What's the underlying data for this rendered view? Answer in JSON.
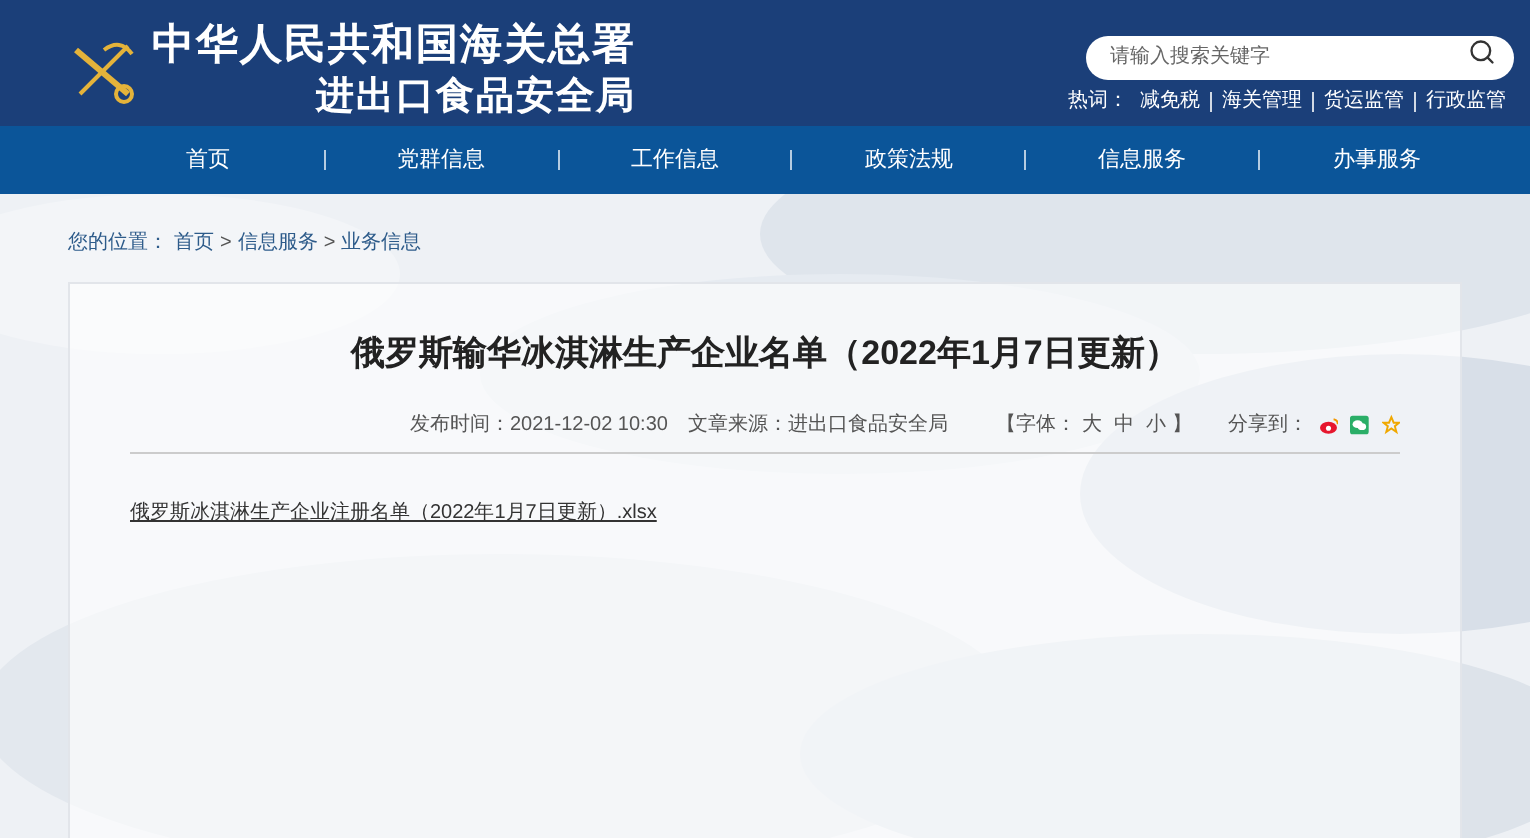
{
  "header": {
    "title_line1": "中华人民共和国海关总署",
    "title_line2": "进出口食品安全局",
    "search": {
      "placeholder": "请输入搜索关键字"
    },
    "hot_label": "热词：",
    "hot_words": [
      "减免税",
      "海关管理",
      "货运监管",
      "行政监管"
    ]
  },
  "nav": [
    "首页",
    "党群信息",
    "工作信息",
    "政策法规",
    "信息服务",
    "办事服务"
  ],
  "breadcrumb": {
    "label": "您的位置：",
    "items": [
      "首页",
      "信息服务",
      "业务信息"
    ],
    "separator": ">"
  },
  "article": {
    "title": "俄罗斯输华冰淇淋生产企业名单（2022年1月7日更新）",
    "publish": "发布时间：2021-12-02 10:30",
    "source": "文章来源：进出口食品安全局",
    "font_open": "【字体：",
    "font_sizes": [
      "大",
      "中",
      "小"
    ],
    "font_close": "】",
    "share_label": "分享到：",
    "attachment": "俄罗斯冰淇淋生产企业注册名单（2022年1月7日更新）.xlsx"
  }
}
